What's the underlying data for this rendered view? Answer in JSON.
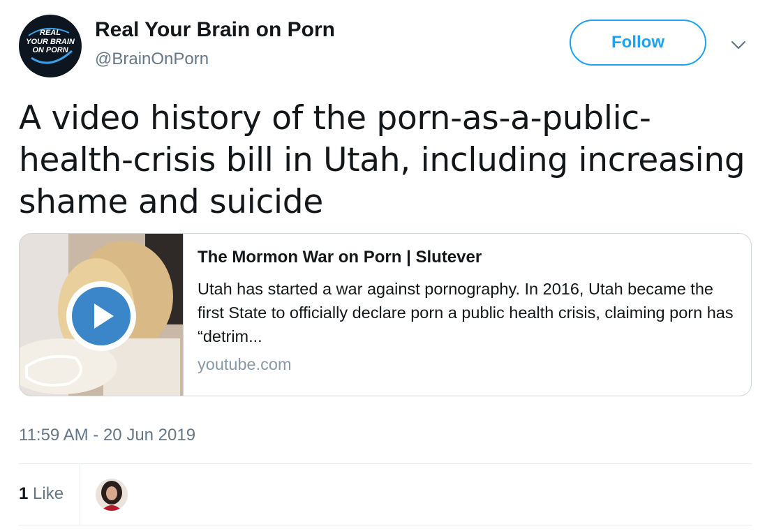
{
  "author": {
    "display_name": "Real Your Brain on Porn",
    "handle": "@BrainOnPorn",
    "avatar_logo_lines": [
      "REAL",
      "YOUR BRAIN",
      "ON PORN"
    ]
  },
  "follow_button": {
    "label": "Follow"
  },
  "menu_caret_icon": "chevron-down-icon",
  "tweet": {
    "text": "A video history of the porn-as-a-public-health-crisis bill in Utah, including increasing shame and suicide"
  },
  "card": {
    "title": "The Mormon War on Porn | Slutever",
    "description": "Utah has started a war against pornography. In 2016, Utah became the first State to officially declare porn a public health crisis, claiming porn has “detrim...",
    "domain": "youtube.com",
    "play_icon": "play-icon"
  },
  "timestamp": "11:59 AM - 20 Jun 2019",
  "likes": {
    "count": "1",
    "label": "Like"
  },
  "colors": {
    "accent": "#1da1f2",
    "text": "#14171a",
    "secondary": "#657786",
    "border": "#ccd6dd",
    "play_button": "#3a86c8"
  }
}
